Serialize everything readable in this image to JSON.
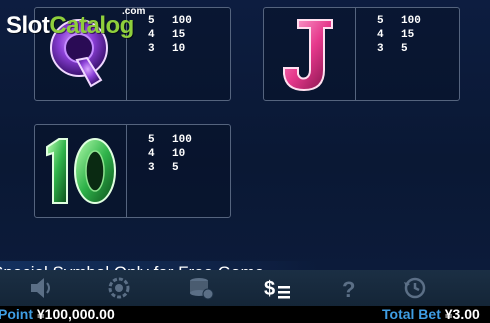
{
  "logo": {
    "slot": "Slot",
    "catalog": "Catalog",
    "com": ".com"
  },
  "paytable": [
    {
      "symbol": "Q",
      "icon": "purple-q-gem-icon",
      "color": "#8a3fd6",
      "pays": [
        {
          "count": "5",
          "value": "100"
        },
        {
          "count": "4",
          "value": "15"
        },
        {
          "count": "3",
          "value": "10"
        }
      ]
    },
    {
      "symbol": "J",
      "icon": "pink-j-gem-icon",
      "color": "#e6398c",
      "pays": [
        {
          "count": "5",
          "value": "100"
        },
        {
          "count": "4",
          "value": "15"
        },
        {
          "count": "3",
          "value": "5"
        }
      ]
    },
    {
      "symbol": "10",
      "icon": "green-ten-gem-icon",
      "color": "#2fb34a",
      "pays": [
        {
          "count": "5",
          "value": "100"
        },
        {
          "count": "4",
          "value": "10"
        },
        {
          "count": "3",
          "value": "5"
        }
      ]
    }
  ],
  "banner": {
    "text": "Special Symbol Only for Free Game"
  },
  "toolbar": {
    "buttons": [
      {
        "name": "sound",
        "icon": "speaker-icon"
      },
      {
        "name": "autoplay",
        "icon": "gear-refresh-icon"
      },
      {
        "name": "bet",
        "icon": "coin-stack-icon"
      },
      {
        "name": "paytable",
        "icon": "dollar-list-icon",
        "active": true
      },
      {
        "name": "help",
        "icon": "question-icon"
      },
      {
        "name": "history",
        "icon": "history-clock-icon"
      }
    ]
  },
  "status": {
    "point_label": "Point",
    "point_value": "¥100,000.00",
    "bet_label": "Total Bet",
    "bet_value": "¥3.00"
  }
}
